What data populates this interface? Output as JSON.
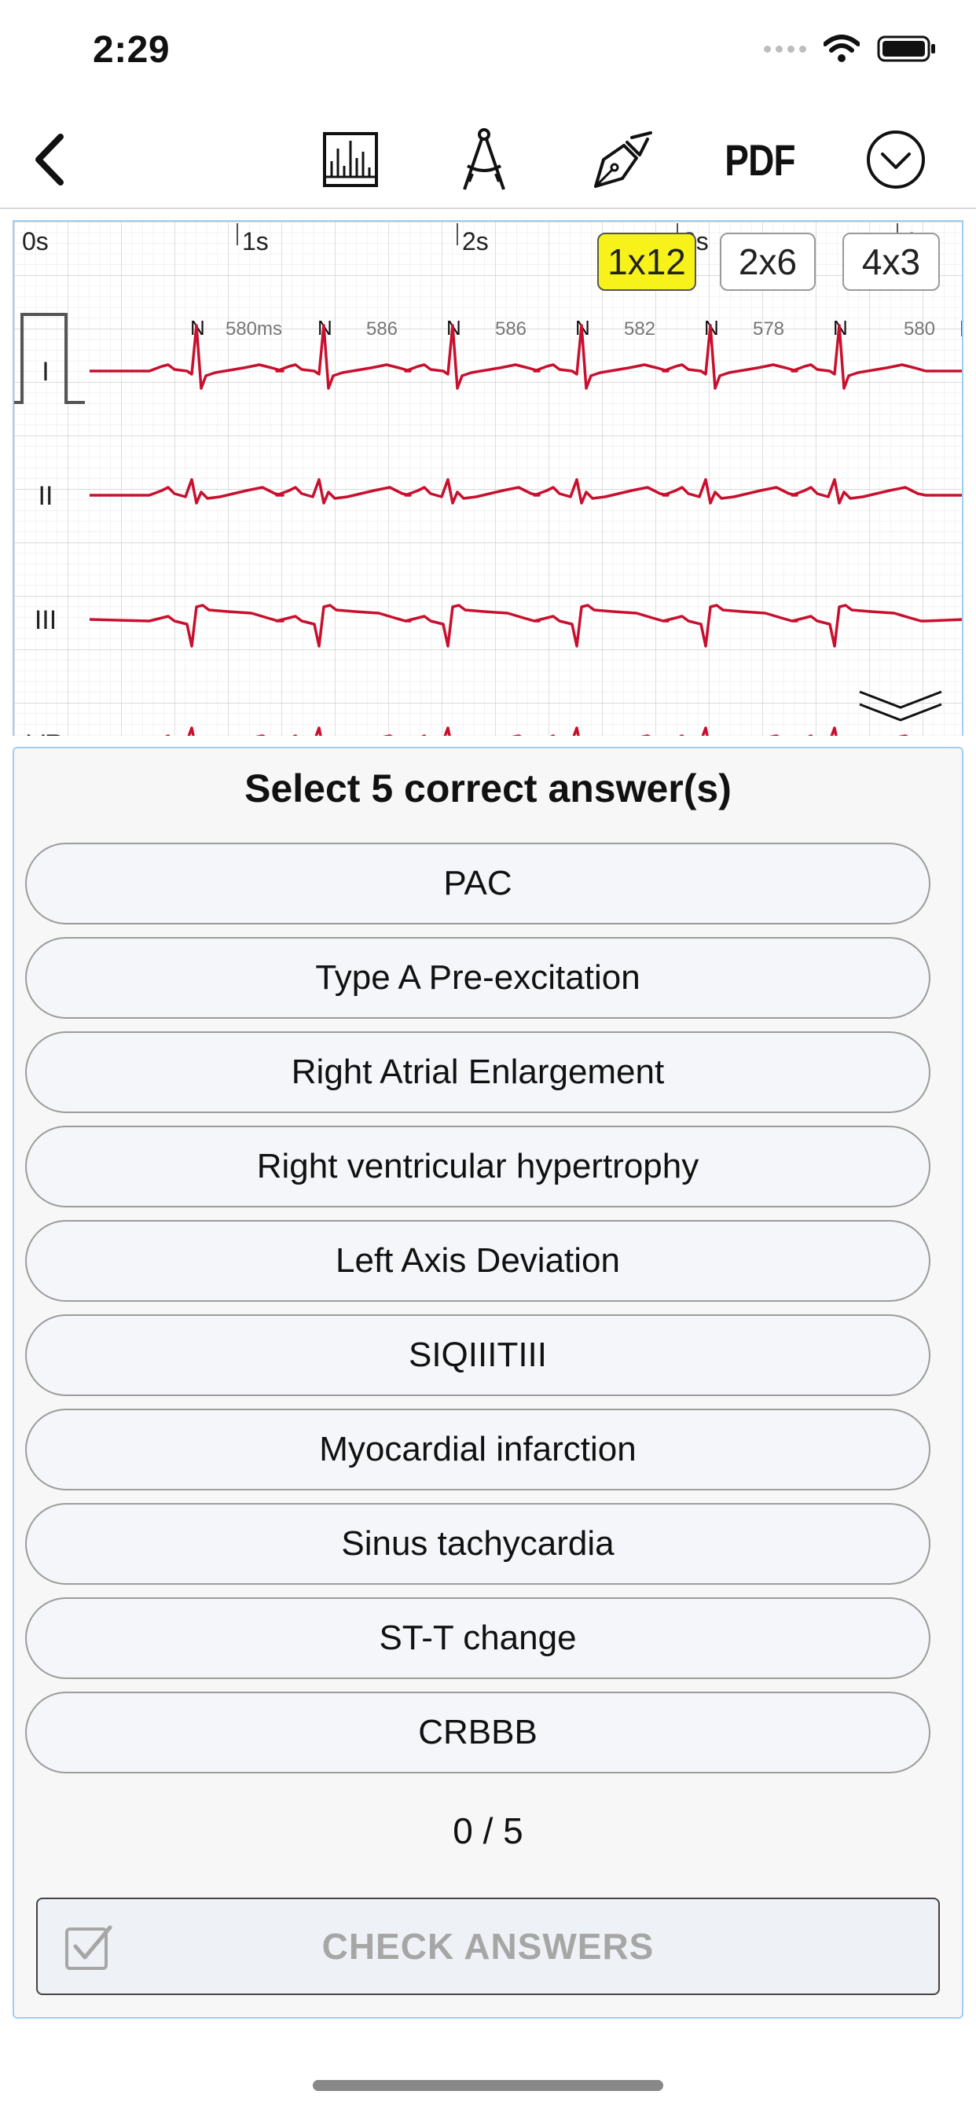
{
  "status_bar": {
    "time": "2:29"
  },
  "toolbar": {
    "back_icon": "chevron-left-icon",
    "tools": [
      {
        "name": "measure-chart-icon"
      },
      {
        "name": "calipers-icon"
      },
      {
        "name": "pen-icon"
      }
    ],
    "pdf_label": "PDF",
    "more_icon": "chevron-circle-down-icon"
  },
  "ecg": {
    "time_marks": [
      "0s",
      "1s",
      "2s",
      "3s",
      "4s"
    ],
    "layout_options": [
      {
        "label": "1x12",
        "active": true
      },
      {
        "label": "2x6",
        "active": false
      },
      {
        "label": "4x3",
        "active": false
      }
    ],
    "beat_labels": [
      "N",
      "N",
      "N",
      "N",
      "N",
      "N"
    ],
    "rr_intervals": [
      "580ms",
      "586",
      "586",
      "582",
      "578",
      "580"
    ],
    "leads": [
      "I",
      "II",
      "III",
      "VR"
    ],
    "trace_color": "#c8102e",
    "collapse_icon": "double-chevron-down-icon"
  },
  "quiz": {
    "heading": "Select 5 correct answer(s)",
    "options": [
      "PAC",
      "Type A Pre-excitation",
      "Right Atrial Enlargement",
      "Right ventricular hypertrophy",
      "Left Axis Deviation",
      "SIQIIITIII",
      "Myocardial infarction",
      "Sinus tachycardia",
      "ST-T change",
      "CRBBB"
    ],
    "score": "0 / 5",
    "check_label": "CHECK ANSWERS"
  }
}
